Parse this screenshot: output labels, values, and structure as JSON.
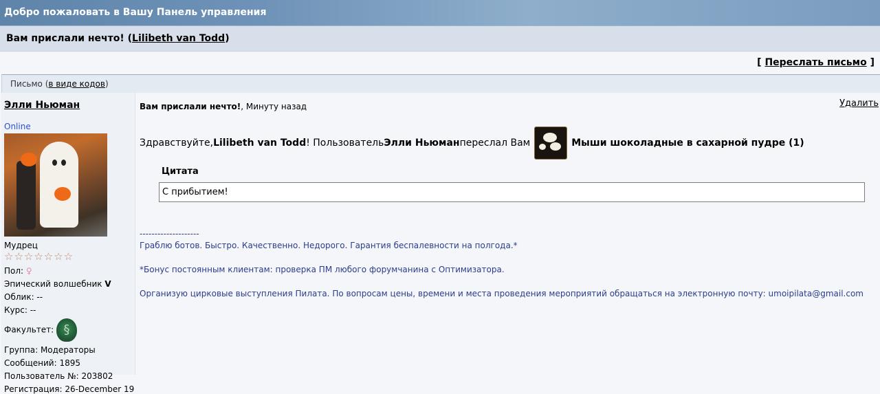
{
  "topbar": {
    "title": "Добро пожаловать в Вашу Панель управления"
  },
  "subject": {
    "prefix": "Вам прислали нечто! (",
    "name": "Lilibeth van Todd",
    "suffix": ")"
  },
  "forward": {
    "open": "[ ",
    "label": "Переслать письмо",
    "close": " ]"
  },
  "letter_header": {
    "label": "Письмо (",
    "link": "в виде кодов",
    "close": ")"
  },
  "sidebar": {
    "author": "Элли Ньюман",
    "status": "Online",
    "rank": "Мудрец",
    "stars": "☆☆☆☆☆☆☆",
    "gender_label": "Пол:",
    "gender_icon": "♀",
    "title_line": "Эпический волшебник",
    "title_level": "V",
    "appearance": "Облик: --",
    "course": "Курс: --",
    "faculty_label": "Факультет:",
    "faculty_icon": "§",
    "group": "Группа: Модераторы",
    "posts": "Сообщений: 1895",
    "user_no": "Пользователь №: 203802",
    "registered": "Регистрация: 26-December 19"
  },
  "message": {
    "title": "Вам прислали нечто!",
    "time": ", Минуту назад",
    "delete": "Удалить",
    "greet_1": "Здравствуйте, ",
    "recipient": "Lilibeth van Todd",
    "greet_2": "! Пользователь ",
    "sender": "Элли Ньюман",
    "greet_3": " переслал Вам",
    "gift": "Мыши шоколадные в сахарной пудре (1)",
    "quote_label": "Цитата",
    "quote_text": "С прибытием!"
  },
  "signature": {
    "dashes": "--------------------",
    "line1": "Граблю ботов. Быстро. Качественно. Недорого. Гарантия беспалевности на полгода.*",
    "line2": "*Бонус постоянным клиентам: проверка ПМ любого форумчанина с Оптимизатора.",
    "line3": "Организую цирковые выступления Пилата. По вопросам цены, времени и места проведения мероприятий обращаться на электронную почту: umoipilata@gmail.com"
  }
}
